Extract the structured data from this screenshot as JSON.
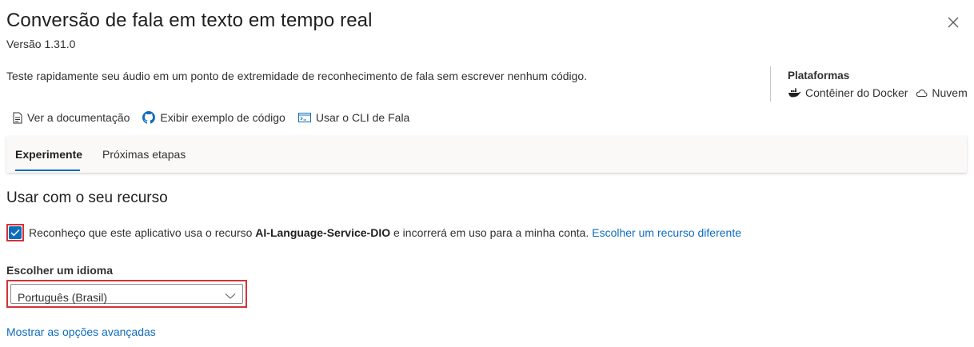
{
  "header": {
    "title": "Conversão de fala em texto em tempo real",
    "version": "Versão 1.31.0",
    "description": "Teste rapidamente seu áudio em um ponto de extremidade de reconhecimento de fala sem escrever nenhum código."
  },
  "platforms": {
    "title": "Plataformas",
    "items": [
      {
        "label": "Contêiner do Docker",
        "icon": "docker-icon"
      },
      {
        "label": "Nuvem",
        "icon": "cloud-icon"
      }
    ]
  },
  "links": [
    {
      "label": "Ver a documentação",
      "icon": "document-icon"
    },
    {
      "label": "Exibir exemplo de código",
      "icon": "github-icon"
    },
    {
      "label": "Usar o CLI de Fala",
      "icon": "terminal-icon"
    }
  ],
  "tabs": [
    {
      "label": "Experimente",
      "active": true
    },
    {
      "label": "Próximas etapas",
      "active": false
    }
  ],
  "section": {
    "title": "Usar com o seu recurso",
    "ack_prefix": "Reconheço que este aplicativo usa o recurso ",
    "ack_resource": "AI-Language-Service-DIO",
    "ack_suffix": " e incorrerá em uso para a minha conta.",
    "ack_link": "Escolher um recurso diferente",
    "ack_checked": true,
    "language_label": "Escolher um idioma",
    "language_value": "Português (Brasil)",
    "advanced_link": "Mostrar as opções avançadas"
  },
  "colors": {
    "accent": "#0f6cbd",
    "highlight": "#d13438"
  }
}
